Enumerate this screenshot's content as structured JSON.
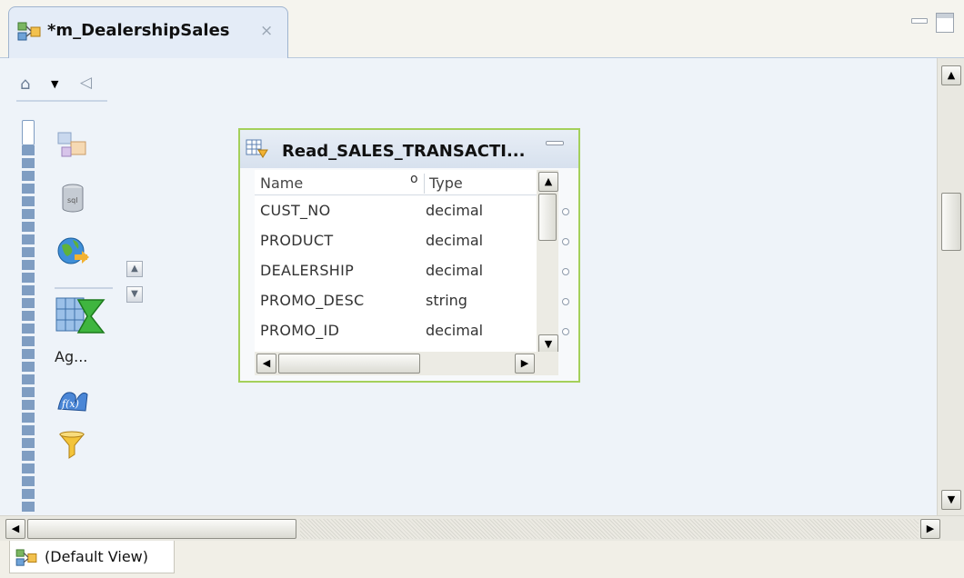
{
  "editor": {
    "tab_title": "*m_DealershipSales",
    "close_glyph": "×"
  },
  "palette": {
    "select_glyph": "⌂",
    "collapse_glyph": "◁",
    "items": [
      {
        "icon": "mapping-icon"
      },
      {
        "icon": "database-icon"
      },
      {
        "icon": "web-service-icon"
      },
      {
        "icon": "aggregator-icon",
        "label": "Ag..."
      },
      {
        "icon": "expression-icon"
      },
      {
        "icon": "filter-icon"
      }
    ],
    "label": "Ag...",
    "scroll_up": "▲",
    "scroll_down": "▼"
  },
  "transformation": {
    "title": "Read_SALES_TRANSACTI...",
    "columns": {
      "name": "Name",
      "sort": "o",
      "type": "Type"
    },
    "rows": [
      {
        "name": "CUST_NO",
        "type": "decimal"
      },
      {
        "name": "PRODUCT",
        "type": "decimal"
      },
      {
        "name": "DEALERSHIP",
        "type": "decimal"
      },
      {
        "name": "PROMO_DESC",
        "type": "string"
      },
      {
        "name": "PROMO_ID",
        "type": "decimal"
      }
    ],
    "border_color": "#a4d05b"
  },
  "scroll_glyphs": {
    "up": "▲",
    "down": "▼",
    "left": "◀",
    "right": "▶"
  },
  "status": {
    "view_label": "(Default View)"
  }
}
